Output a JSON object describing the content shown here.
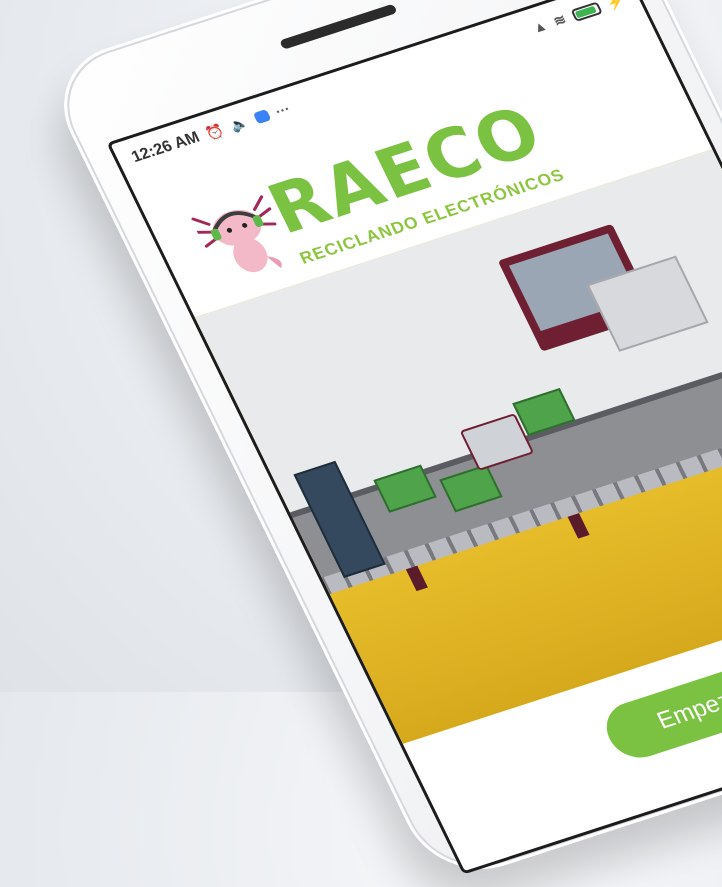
{
  "status_bar": {
    "time": "12:26 AM",
    "icons": [
      "alarm-icon",
      "volume-icon",
      "chat-icon",
      "more-icon"
    ],
    "right_icons": [
      "signal-icon",
      "wifi-icon",
      "battery-icon",
      "charging-icon"
    ]
  },
  "logo": {
    "title": "RAECO",
    "subtitle": "RECICLANDO ELECTRÓNICOS",
    "mascot": "axolotl-mascot-icon",
    "title_color": "#7cc242"
  },
  "hero": {
    "illustration": "conveyor-belt-electronics-illustration",
    "background_color": "#f3cf3a"
  },
  "start_button": {
    "label": "Empezar",
    "color": "#7cc242"
  }
}
